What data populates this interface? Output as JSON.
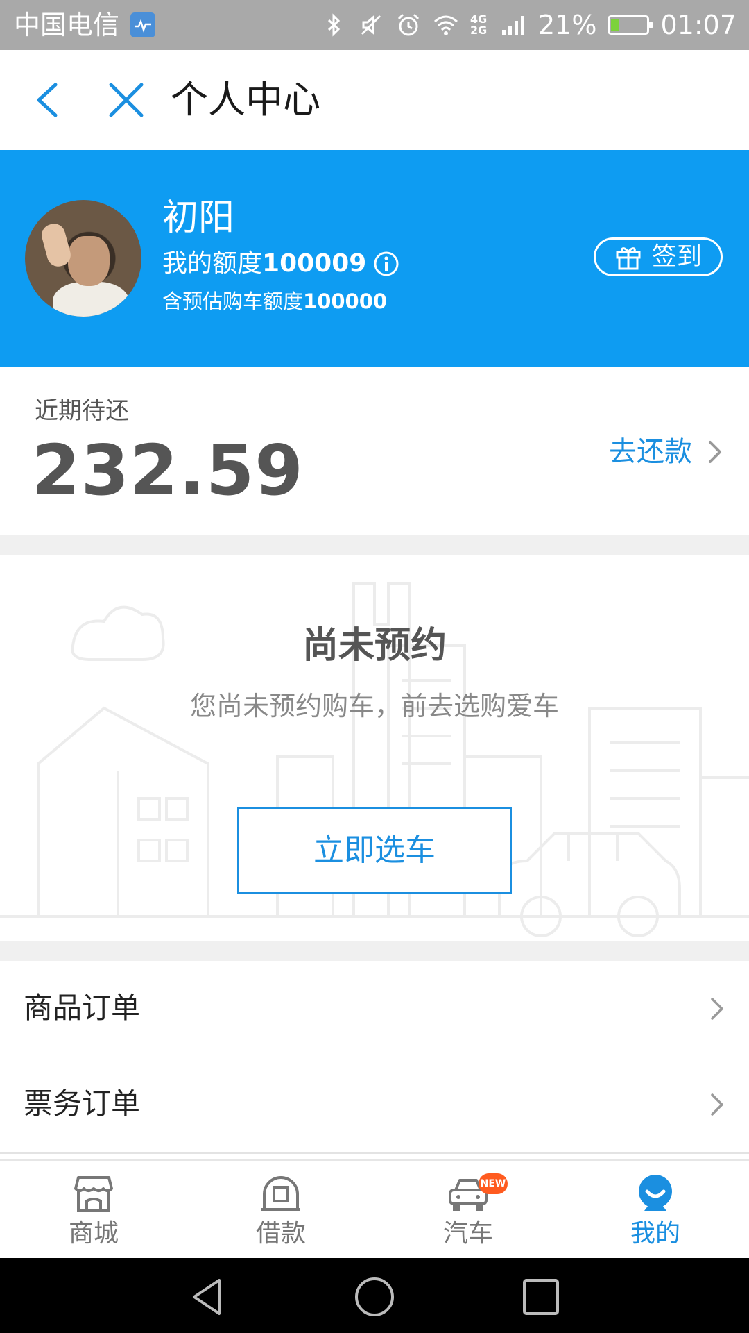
{
  "status_bar": {
    "carrier": "中国电信",
    "network_top": "4G",
    "network_bottom": "2G",
    "battery_percent": "21%",
    "battery_level": 0.21,
    "time": "01:07",
    "icons": [
      "health-app-icon",
      "bluetooth-icon",
      "mute-icon",
      "alarm-icon",
      "wifi-icon",
      "signal-icon",
      "battery-icon"
    ]
  },
  "nav": {
    "title": "个人中心"
  },
  "profile": {
    "name": "初阳",
    "quota_label": "我的额度",
    "quota_value": "100009",
    "car_quota_label": "含预估购车额度",
    "car_quota_value": "100000",
    "checkin_label": "签到",
    "accent_color": "#0e9cf2"
  },
  "repayment": {
    "label": "近期待还",
    "amount": "232.59",
    "action_label": "去还款"
  },
  "reservation": {
    "title": "尚未预约",
    "subtitle": "您尚未预约购车，前去选购爱车",
    "button_label": "立即选车"
  },
  "menu": {
    "items": [
      {
        "label": "商品订单"
      },
      {
        "label": "票务订单"
      }
    ]
  },
  "tabs": [
    {
      "label": "商城",
      "icon": "store-icon",
      "active": false
    },
    {
      "label": "借款",
      "icon": "loan-icon",
      "active": false
    },
    {
      "label": "汽车",
      "icon": "car-icon",
      "active": false,
      "badge": "NEW"
    },
    {
      "label": "我的",
      "icon": "profile-icon",
      "active": true
    }
  ],
  "colors": {
    "primary": "#1b8fe0",
    "badge": "#ff5b1f"
  }
}
